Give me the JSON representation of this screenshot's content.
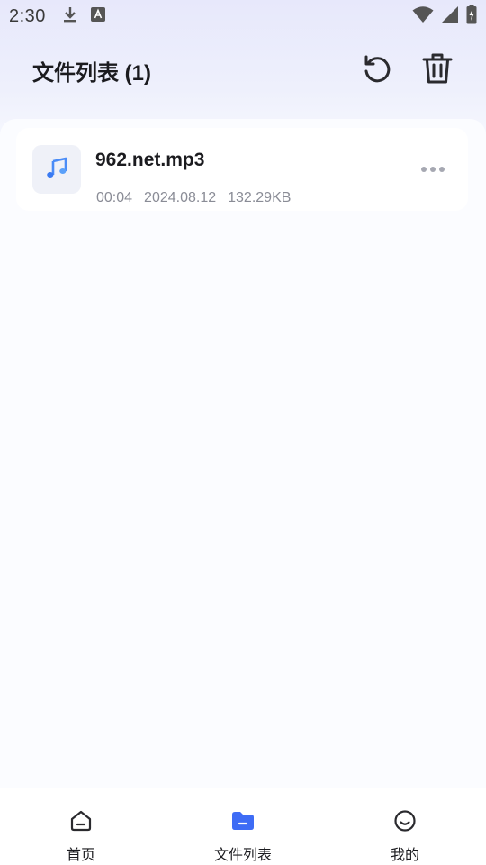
{
  "status_bar": {
    "time": "2:30",
    "icons": [
      "download-icon",
      "keyboard-a-icon",
      "wifi-icon",
      "cell-signal-icon",
      "battery-charging-icon"
    ]
  },
  "header": {
    "title": "文件列表 (1)",
    "actions": [
      "refresh-icon",
      "trash-icon"
    ]
  },
  "files": [
    {
      "name": "962.net.mp3",
      "duration": "00:04",
      "date": "2024.08.12",
      "size": "132.29KB",
      "icon": "music-note-icon"
    }
  ],
  "bottom_nav": {
    "items": [
      {
        "label": "首页",
        "icon": "home-icon"
      },
      {
        "label": "文件列表",
        "icon": "folder-icon",
        "active": true
      },
      {
        "label": "我的",
        "icon": "smile-face-icon"
      }
    ]
  },
  "colors": {
    "accent": "#3e6cf5",
    "music_icon": "#4a8cf7",
    "header_gradient_top": "#e7e8fb",
    "background": "#fafbff",
    "meta_text": "#8a8c96"
  }
}
